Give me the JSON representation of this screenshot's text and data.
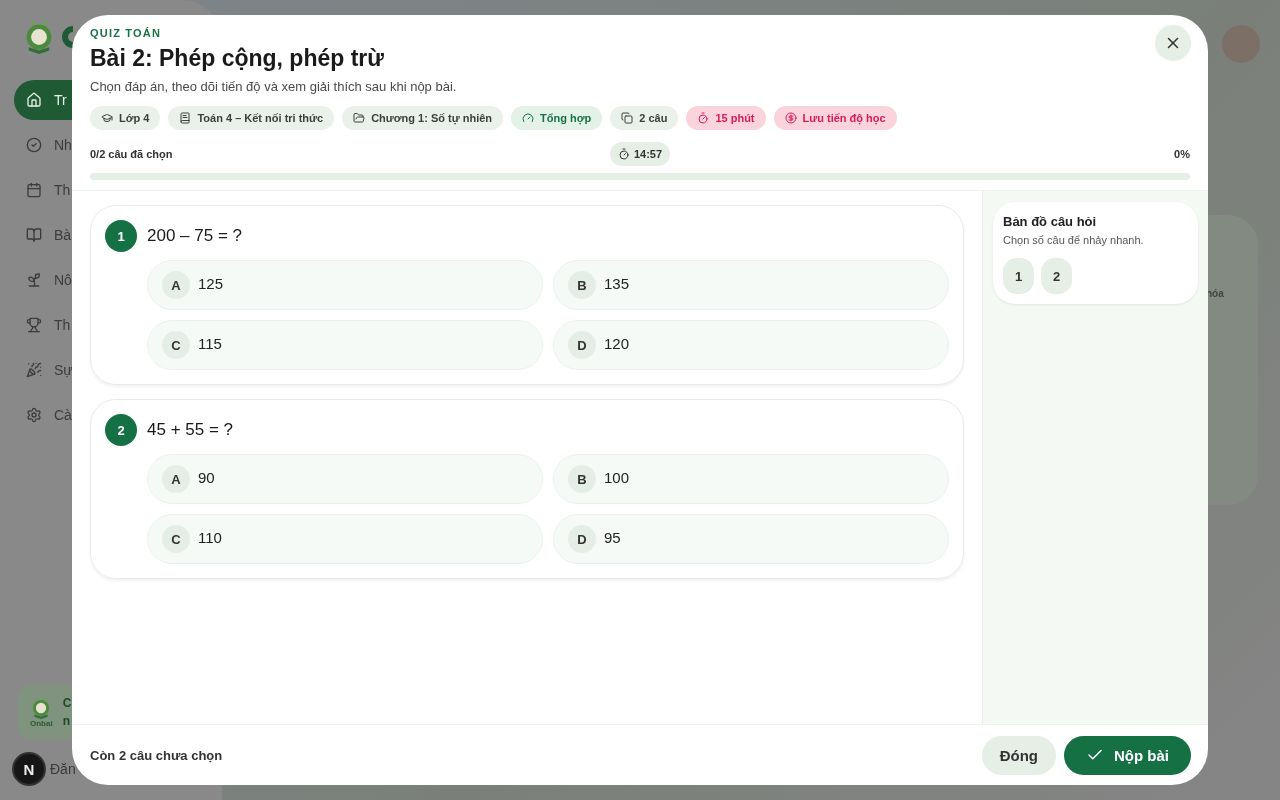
{
  "background": {
    "nav": [
      {
        "label": "Tr",
        "selected": true
      },
      {
        "label": "Nh",
        "selected": false
      },
      {
        "label": "Th",
        "selected": false
      },
      {
        "label": "Bà",
        "selected": false
      },
      {
        "label": "Nô",
        "selected": false
      },
      {
        "label": "Th",
        "selected": false
      },
      {
        "label": "Sự",
        "selected": false
      },
      {
        "label": "Cà",
        "selected": false
      }
    ],
    "promo": {
      "logo_text": "Onbai",
      "title": "C",
      "subtitle": "n"
    },
    "user": {
      "initial": "N",
      "label": "Đăn"
    },
    "side_card_text": "hóa"
  },
  "modal": {
    "eyebrow": "QUIZ TOÁN",
    "title": "Bài 2: Phép cộng, phép trừ",
    "subtitle": "Chọn đáp án, theo dõi tiến độ và xem giải thích sau khi nộp bài.",
    "chips": [
      {
        "label": "Lớp 4",
        "kind": "info"
      },
      {
        "label": "Toán 4 – Kết nối tri thức",
        "kind": "info"
      },
      {
        "label": "Chương 1: Số tự nhiên",
        "kind": "info"
      },
      {
        "label": "Tổng hợp",
        "kind": "accent"
      },
      {
        "label": "2 câu",
        "kind": "info"
      },
      {
        "label": "15 phút",
        "kind": "alert"
      },
      {
        "label": "Lưu tiến độ học",
        "kind": "alert"
      }
    ],
    "progress": {
      "answered": "0/2 câu đã chọn",
      "timer": "14:57",
      "percent": "0%",
      "level": 0
    },
    "questions": [
      {
        "number": "1",
        "text": "200 – 75 = ?",
        "options": [
          {
            "letter": "A",
            "text": "125",
            "selected": false
          },
          {
            "letter": "B",
            "text": "135",
            "selected": false
          },
          {
            "letter": "C",
            "text": "115",
            "selected": false
          },
          {
            "letter": "D",
            "text": "120",
            "selected": false
          }
        ]
      },
      {
        "number": "2",
        "text": "45 + 55 = ?",
        "options": [
          {
            "letter": "A",
            "text": "90",
            "selected": false
          },
          {
            "letter": "B",
            "text": "100",
            "selected": false
          },
          {
            "letter": "C",
            "text": "110",
            "selected": false
          },
          {
            "letter": "D",
            "text": "95",
            "selected": false
          }
        ]
      }
    ],
    "map": {
      "title": "Bản đồ câu hỏi",
      "hint": "Chọn số câu để nhảy nhanh.",
      "numbers": [
        "1",
        "2"
      ]
    },
    "footer": {
      "status": "Còn 2 câu chưa chọn",
      "close": "Đóng",
      "submit": "Nộp bài"
    }
  }
}
